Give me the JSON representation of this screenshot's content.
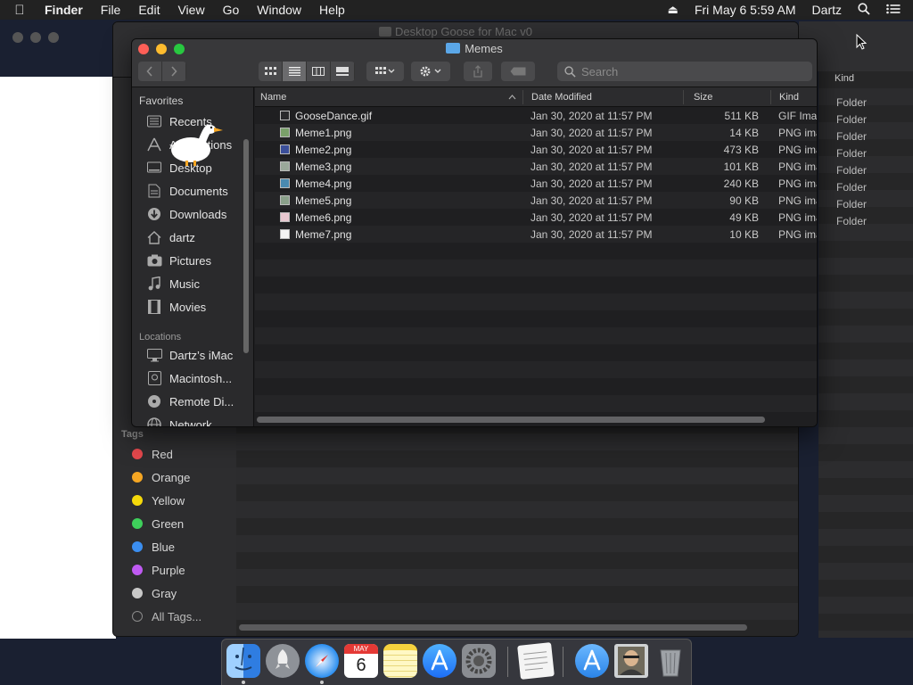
{
  "menubar": {
    "app": "Finder",
    "items": [
      "File",
      "Edit",
      "View",
      "Go",
      "Window",
      "Help"
    ],
    "clock": "Fri May 6  5:59 AM",
    "user": "Dartz"
  },
  "back_window": {
    "title": "Desktop Goose for Mac v0",
    "tags_header": "Tags",
    "tags": [
      {
        "label": "Red",
        "color": "#e5484d"
      },
      {
        "label": "Orange",
        "color": "#f5a623"
      },
      {
        "label": "Yellow",
        "color": "#f5d90a"
      },
      {
        "label": "Green",
        "color": "#3ecf5b"
      },
      {
        "label": "Blue",
        "color": "#3b8ef0"
      },
      {
        "label": "Purple",
        "color": "#bf5af2"
      },
      {
        "label": "Gray",
        "color": "#c8c8c8"
      },
      {
        "label": "All Tags..."
      }
    ],
    "kind_header": "Kind",
    "kind_cells": [
      "Folder",
      "Folder",
      "Folder",
      "Folder",
      "Folder",
      "Folder",
      "Folder",
      "Folder"
    ]
  },
  "front_window": {
    "title": "Memes",
    "search_placeholder": "Search",
    "sidebar": {
      "favorites_header": "Favorites",
      "favorites": [
        {
          "label": "Recents",
          "icon": "recents-icon"
        },
        {
          "label": "Applications",
          "icon": "applications-icon"
        },
        {
          "label": "Desktop",
          "icon": "desktop-icon"
        },
        {
          "label": "Documents",
          "icon": "documents-icon"
        },
        {
          "label": "Downloads",
          "icon": "downloads-icon"
        },
        {
          "label": "dartz",
          "icon": "home-icon"
        },
        {
          "label": "Pictures",
          "icon": "pictures-icon"
        },
        {
          "label": "Music",
          "icon": "music-icon"
        },
        {
          "label": "Movies",
          "icon": "movies-icon"
        }
      ],
      "locations_header": "Locations",
      "locations": [
        {
          "label": "Dartz’s iMac",
          "icon": "computer-icon"
        },
        {
          "label": "Macintosh...",
          "icon": "disk-icon"
        },
        {
          "label": "Remote Di...",
          "icon": "remote-disc-icon"
        },
        {
          "label": "Network",
          "icon": "network-icon"
        }
      ]
    },
    "columns": {
      "name": "Name",
      "date": "Date Modified",
      "size": "Size",
      "kind": "Kind"
    },
    "files": [
      {
        "name": "GooseDance.gif",
        "date": "Jan 30, 2020 at 11:57 PM",
        "size": "511 KB",
        "kind": "GIF Image"
      },
      {
        "name": "Meme1.png",
        "date": "Jan 30, 2020 at 11:57 PM",
        "size": "14 KB",
        "kind": "PNG image"
      },
      {
        "name": "Meme2.png",
        "date": "Jan 30, 2020 at 11:57 PM",
        "size": "473 KB",
        "kind": "PNG image"
      },
      {
        "name": "Meme3.png",
        "date": "Jan 30, 2020 at 11:57 PM",
        "size": "101 KB",
        "kind": "PNG image"
      },
      {
        "name": "Meme4.png",
        "date": "Jan 30, 2020 at 11:57 PM",
        "size": "240 KB",
        "kind": "PNG image"
      },
      {
        "name": "Meme5.png",
        "date": "Jan 30, 2020 at 11:57 PM",
        "size": "90 KB",
        "kind": "PNG image"
      },
      {
        "name": "Meme6.png",
        "date": "Jan 30, 2020 at 11:57 PM",
        "size": "49 KB",
        "kind": "PNG image"
      },
      {
        "name": "Meme7.png",
        "date": "Jan 30, 2020 at 11:57 PM",
        "size": "10 KB",
        "kind": "PNG image"
      }
    ]
  },
  "dock": {
    "calendar_month": "MAY",
    "calendar_day": "6"
  }
}
